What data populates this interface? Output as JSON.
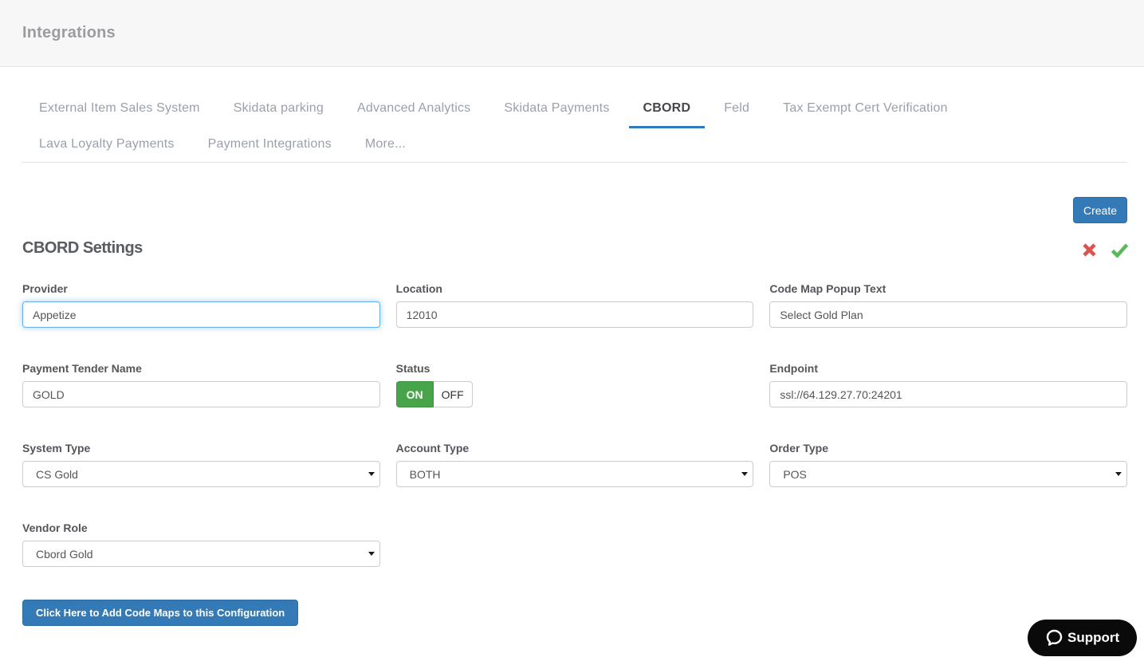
{
  "page": {
    "title": "Integrations"
  },
  "tabs": {
    "rows": [
      [
        {
          "label": "External Item Sales System",
          "active": false
        },
        {
          "label": "Skidata parking",
          "active": false
        },
        {
          "label": "Advanced Analytics",
          "active": false
        },
        {
          "label": "Skidata Payments",
          "active": false
        },
        {
          "label": "CBORD",
          "active": true
        },
        {
          "label": "Feld",
          "active": false
        },
        {
          "label": "Tax Exempt Cert Verification",
          "active": false
        }
      ],
      [
        {
          "label": "Lava Loyalty Payments",
          "active": false
        },
        {
          "label": "Payment Integrations",
          "active": false
        },
        {
          "label": "More...",
          "active": false
        }
      ]
    ]
  },
  "toolbar": {
    "create_label": "Create"
  },
  "settings": {
    "heading": "CBORD Settings"
  },
  "form": {
    "provider": {
      "label": "Provider",
      "value": "Appetize"
    },
    "location": {
      "label": "Location",
      "value": "12010"
    },
    "code_map_popup_text": {
      "label": "Code Map Popup Text",
      "value": "Select Gold Plan"
    },
    "payment_tender_name": {
      "label": "Payment Tender Name",
      "value": "GOLD"
    },
    "status": {
      "label": "Status",
      "on_label": "ON",
      "off_label": "OFF",
      "value": "ON"
    },
    "endpoint": {
      "label": "Endpoint",
      "value": "ssl://64.129.27.70:24201"
    },
    "system_type": {
      "label": "System Type",
      "value": "CS Gold"
    },
    "account_type": {
      "label": "Account Type",
      "value": "BOTH"
    },
    "order_type": {
      "label": "Order Type",
      "value": "POS"
    },
    "vendor_role": {
      "label": "Vendor Role",
      "value": "Cbord Gold"
    }
  },
  "actions": {
    "add_code_maps_label": "Click Here to Add Code Maps to this Configuration"
  },
  "support": {
    "label": "Support"
  },
  "colors": {
    "primary_blue": "#337ab7",
    "tab_underline_blue": "#2e7ac0",
    "toggle_on_green": "#48a44a",
    "cancel_red": "#d9534f",
    "confirm_green": "#5cb85c",
    "header_bg": "#f7f7f7"
  }
}
